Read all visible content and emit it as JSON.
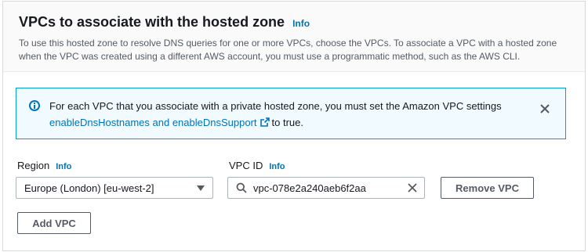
{
  "section": {
    "title": "VPCs to associate with the hosted zone",
    "info_label": "Info",
    "description": "To use this hosted zone to resolve DNS queries for one or more VPCs, choose the VPCs. To associate a VPC with a hosted zone when the VPC was created using a different AWS account, you must use a programmatic method, such as the AWS CLI."
  },
  "alert": {
    "text_before": "For each VPC that you associate with a private hosted zone, you must set the Amazon VPC settings ",
    "link_text": "enableDnsHostnames and enableDnsSupport",
    "text_after": "to true.",
    "icon": "info-icon",
    "color": "#0073bb"
  },
  "region": {
    "label": "Region",
    "info_label": "Info",
    "selected": "Europe (London) [eu-west-2]"
  },
  "vpc": {
    "label": "VPC ID",
    "info_label": "Info",
    "value": "vpc-078e2a240aeb6f2aa"
  },
  "buttons": {
    "remove": "Remove VPC",
    "add": "Add VPC"
  }
}
